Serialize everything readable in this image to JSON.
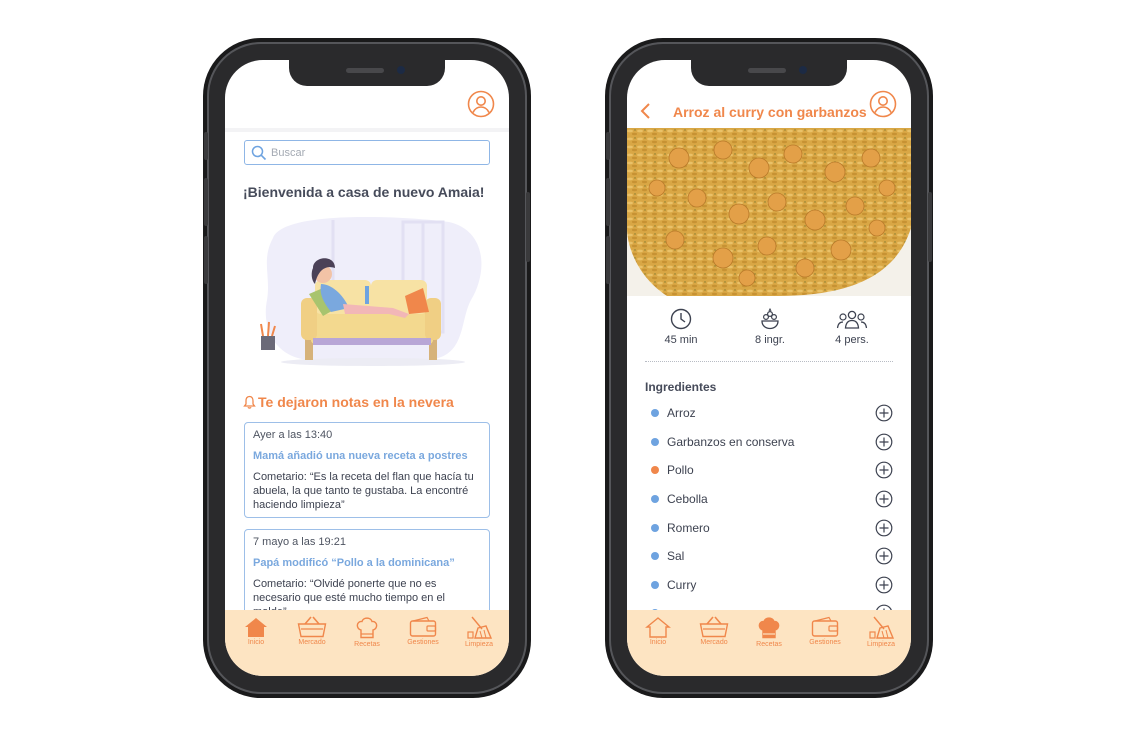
{
  "colors": {
    "accent": "#f0874b",
    "tabbar_bg": "#fde4c2",
    "link_blue": "#7aa8de",
    "bullet_blue": "#6ea3e0",
    "bullet_orange": "#f0874b",
    "card_border": "#9dbfe8"
  },
  "home_screen": {
    "search": {
      "placeholder": "Buscar"
    },
    "welcome": "¡Bienvenida a casa de nuevo Amaia!",
    "notes_title": "Te dejaron notas en la nevera",
    "notes": [
      {
        "when": "Ayer a las 13:40",
        "headline": "Mamá añadió una nueva receta a postres",
        "comment": "Cometario: “Es la receta del flan que hacía tu abuela, la que tanto te gustaba. La encontré haciendo limpieza”"
      },
      {
        "when": "7 mayo a las 19:21",
        "headline": "Papá modificó “Pollo a la dominicana”",
        "comment": "Cometario: “Olvidé ponerte que no es necesario que esté mucho tiempo en el molde”"
      }
    ]
  },
  "recipe_screen": {
    "title": "Arroz al curry con garbanzos",
    "stats": {
      "time": "45 min",
      "ingredients": "8 ingr.",
      "people": "4 pers."
    },
    "ingredients_title": "Ingredientes",
    "ingredients": [
      {
        "name": "Arroz",
        "bullet": "blue"
      },
      {
        "name": "Garbanzos en conserva",
        "bullet": "blue"
      },
      {
        "name": "Pollo",
        "bullet": "orange"
      },
      {
        "name": "Cebolla",
        "bullet": "blue"
      },
      {
        "name": "Romero",
        "bullet": "blue"
      },
      {
        "name": "Sal",
        "bullet": "blue"
      },
      {
        "name": "Curry",
        "bullet": "blue"
      }
    ]
  },
  "tabbar": {
    "items": [
      {
        "label": "Inicio",
        "icon": "home-icon"
      },
      {
        "label": "Mercado",
        "icon": "basket-icon"
      },
      {
        "label": "Recetas",
        "icon": "chef-hat-icon"
      },
      {
        "label": "Gestiones",
        "icon": "wallet-icon"
      },
      {
        "label": "Limpieza",
        "icon": "broom-icon"
      }
    ]
  }
}
